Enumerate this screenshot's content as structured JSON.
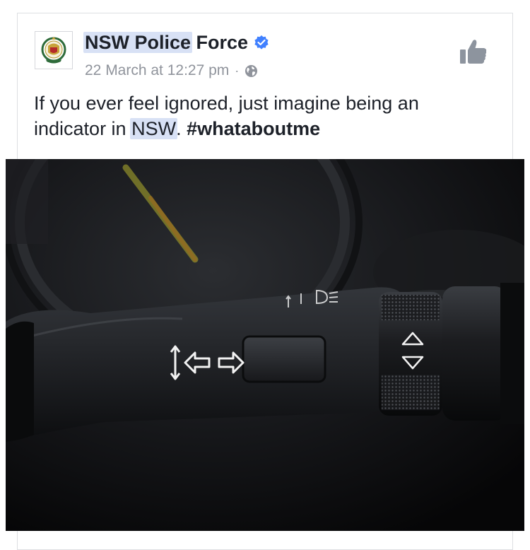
{
  "post": {
    "author": {
      "name_highlight": "NSW Police",
      "name_rest": " Force",
      "verified_icon": "verified-badge-icon",
      "avatar_icon": "police-crest-icon"
    },
    "timestamp": "22 March at 12:27 pm",
    "separator": "·",
    "privacy_icon": "globe-icon",
    "like_icon": "thumbs-up-icon",
    "text": {
      "line1": "If you ever feel ignored, just imagine being an",
      "line2_before": "indicator in ",
      "line2_highlight": "NSW",
      "line2_after": ". ",
      "hashtag": "#whataboutme"
    },
    "photo": {
      "subject": "car-indicator-stalk-photo",
      "symbols": [
        "↕",
        "⇦",
        "⇨",
        "△",
        "▽"
      ]
    }
  },
  "colors": {
    "text_primary": "#1d2129",
    "text_secondary": "#90949c",
    "highlight": "#d8e1f5",
    "verified_blue": "#4080ff",
    "like_grey": "#8d949e",
    "border": "#dddfe2"
  }
}
